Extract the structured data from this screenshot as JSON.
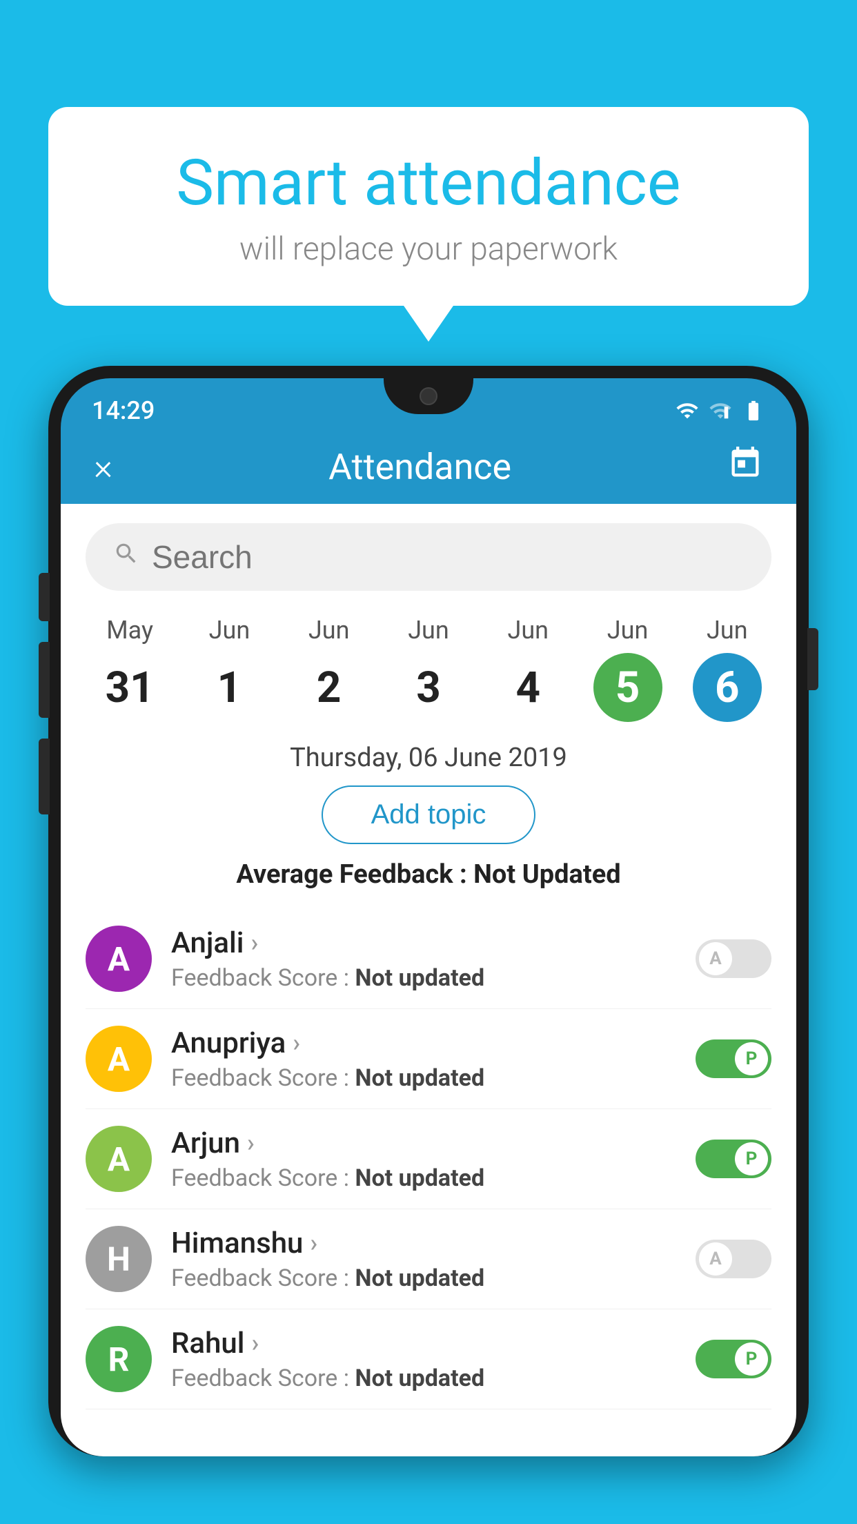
{
  "hero": {
    "title": "Smart attendance",
    "subtitle": "will replace your paperwork"
  },
  "phone": {
    "time": "14:29",
    "app_title": "Attendance",
    "close_label": "×",
    "search_placeholder": "Search",
    "selected_date": "Thursday, 06 June 2019",
    "add_topic_label": "Add topic",
    "avg_feedback_label": "Average Feedback : ",
    "avg_feedback_value": "Not Updated",
    "calendar": {
      "days": [
        {
          "month": "May",
          "num": "31",
          "style": "normal"
        },
        {
          "month": "Jun",
          "num": "1",
          "style": "normal"
        },
        {
          "month": "Jun",
          "num": "2",
          "style": "normal"
        },
        {
          "month": "Jun",
          "num": "3",
          "style": "normal"
        },
        {
          "month": "Jun",
          "num": "4",
          "style": "normal"
        },
        {
          "month": "Jun",
          "num": "5",
          "style": "green"
        },
        {
          "month": "Jun",
          "num": "6",
          "style": "blue"
        }
      ]
    },
    "students": [
      {
        "name": "Anjali",
        "avatar_letter": "A",
        "avatar_color": "#9C27B0",
        "feedback": "Not updated",
        "toggle": "off",
        "toggle_label": "A"
      },
      {
        "name": "Anupriya",
        "avatar_letter": "A",
        "avatar_color": "#FFC107",
        "feedback": "Not updated",
        "toggle": "on",
        "toggle_label": "P"
      },
      {
        "name": "Arjun",
        "avatar_letter": "A",
        "avatar_color": "#8BC34A",
        "feedback": "Not updated",
        "toggle": "on",
        "toggle_label": "P"
      },
      {
        "name": "Himanshu",
        "avatar_letter": "H",
        "avatar_color": "#9E9E9E",
        "feedback": "Not updated",
        "toggle": "off",
        "toggle_label": "A"
      },
      {
        "name": "Rahul",
        "avatar_letter": "R",
        "avatar_color": "#4CAF50",
        "feedback": "Not updated",
        "toggle": "on",
        "toggle_label": "P"
      }
    ]
  }
}
